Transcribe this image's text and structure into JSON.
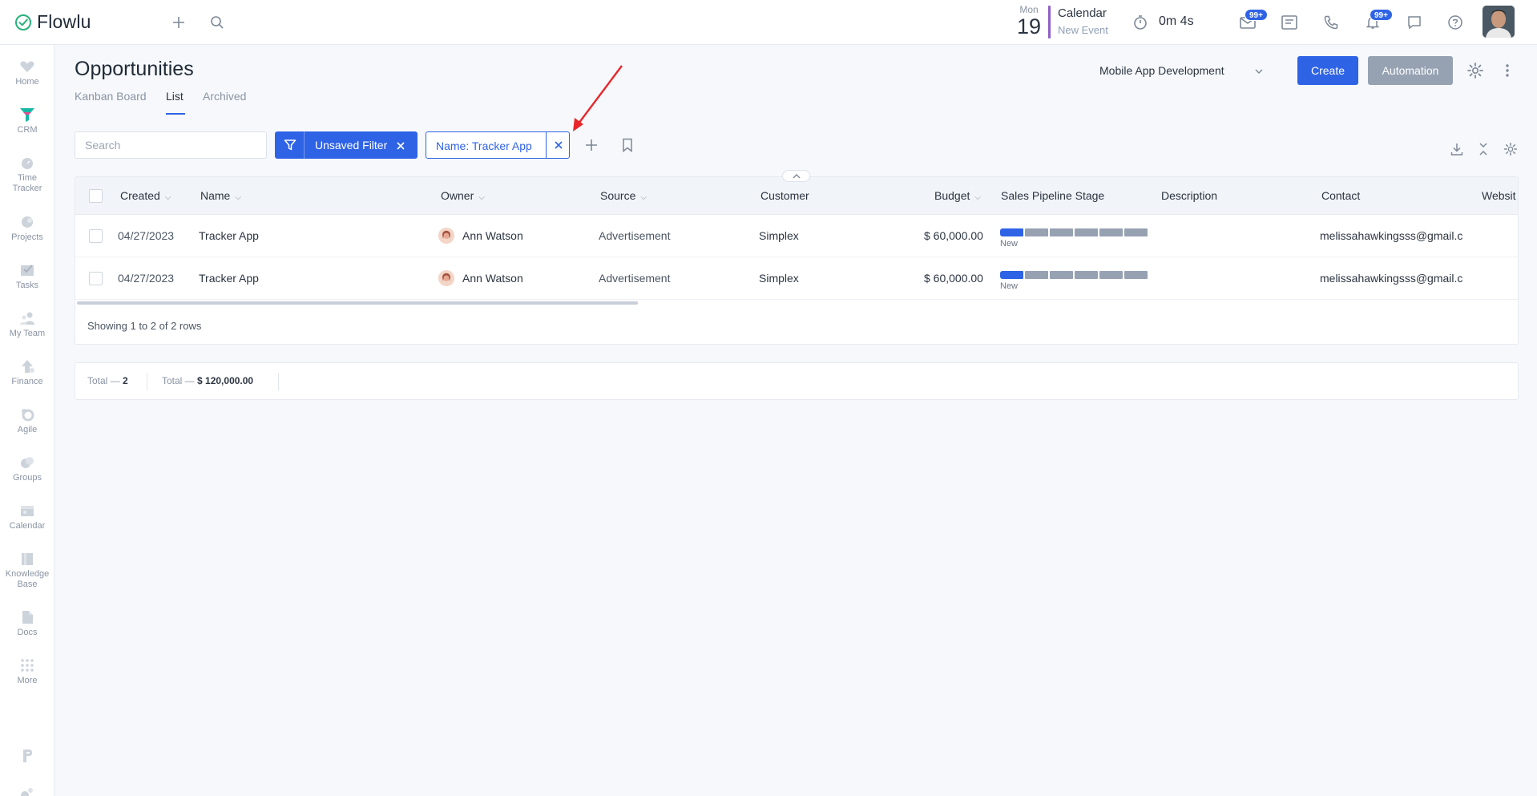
{
  "app": {
    "name": "Flowlu"
  },
  "topbar": {
    "calendar": {
      "day_of_week": "Mon",
      "day": "19",
      "title": "Calendar",
      "subtitle": "New Event"
    },
    "timer": "0m 4s",
    "badges": {
      "mail": "99+",
      "notifications": "99+"
    }
  },
  "sidebar": {
    "items": [
      {
        "label": "Home",
        "icon": "heart-icon"
      },
      {
        "label": "CRM",
        "icon": "funnel-icon"
      },
      {
        "label": "Time Tracker",
        "icon": "clock-icon"
      },
      {
        "label": "Projects",
        "icon": "projects-icon"
      },
      {
        "label": "Tasks",
        "icon": "check-icon"
      },
      {
        "label": "My Team",
        "icon": "team-icon"
      },
      {
        "label": "Finance",
        "icon": "finance-icon"
      },
      {
        "label": "Agile",
        "icon": "agile-icon"
      },
      {
        "label": "Groups",
        "icon": "groups-icon"
      },
      {
        "label": "Calendar",
        "icon": "calendar-icon"
      },
      {
        "label": "Knowledge Base",
        "icon": "book-icon"
      },
      {
        "label": "Docs",
        "icon": "docs-icon"
      },
      {
        "label": "More",
        "icon": "grid-icon"
      }
    ]
  },
  "header": {
    "title": "Opportunities",
    "tabs": [
      {
        "label": "Kanban Board"
      },
      {
        "label": "List"
      },
      {
        "label": "Archived"
      }
    ],
    "pipeline": "Mobile App Development",
    "create_label": "Create",
    "automation_label": "Automation"
  },
  "filters": {
    "search_placeholder": "Search",
    "unsaved_filter_label": "Unsaved Filter",
    "chip_label": "Name: Tracker App"
  },
  "table": {
    "columns": [
      "Created",
      "Name",
      "Owner",
      "Source",
      "Customer",
      "Budget",
      "Sales Pipeline Stage",
      "Description",
      "Contact",
      "Websit"
    ],
    "rows": [
      {
        "created": "04/27/2023",
        "name": "Tracker App",
        "owner": "Ann Watson",
        "source": "Advertisement",
        "customer": "Simplex",
        "budget": "$ 60,000.00",
        "stage": "New",
        "description": "",
        "contact": "melissahawkingsss@gmail.c"
      },
      {
        "created": "04/27/2023",
        "name": "Tracker App",
        "owner": "Ann Watson",
        "source": "Advertisement",
        "customer": "Simplex",
        "budget": "$ 60,000.00",
        "stage": "New",
        "description": "",
        "contact": "melissahawkingsss@gmail.c"
      }
    ],
    "rows_info": "Showing 1 to 2 of 2 rows"
  },
  "totals": {
    "count_label": "Total —",
    "count_value": "2",
    "sum_label": "Total —",
    "sum_value": "$ 120,000.00"
  },
  "colors": {
    "accent": "#2f63e6",
    "crm": "#19b6a6",
    "annotation": "#e8262b"
  }
}
